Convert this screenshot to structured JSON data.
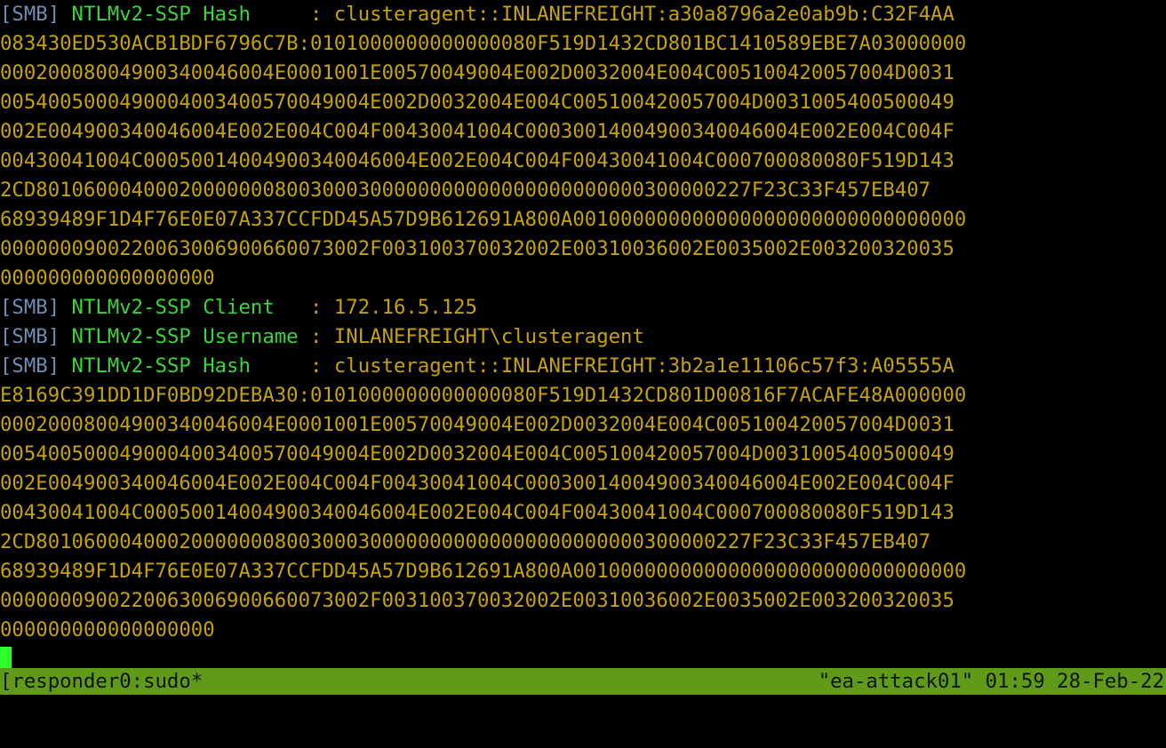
{
  "terminal": {
    "lines": [
      {
        "tag": "[SMB]",
        "label": " NTLMv2-SSP Hash     ",
        "value": ": clusteragent::INLANEFREIGHT:a30a8796a2e0ab9b:C32F4AA"
      },
      {
        "text": "083430ED530ACB1BDF6796C7B:0101000000000000080F519D1432CD801BC1410589EBE7A03000000"
      },
      {
        "text": "0002000800490034004600 4E0001001E00570049004E002D0032004E004C005100420057004D0031"
      },
      {
        "text": "0054005000490004003400570049004E002D0032004E004C005100420057004D0031005400500049"
      },
      {
        "text": "002E00490034004600 4E002E004C004F00430041004C000300140049003400460 04E002E004C004F"
      },
      {
        "text": "00430041004C000500140049003400460 04E002E004C004F00430041004C000700080080F519D143"
      },
      {
        "text": "2CD801060004000200000008003000300000000000000000000000300000227F23C33F457EB407"
      },
      {
        "text": "68939489F1D4F76E0E07A337CCFDD45A57D9B612691A800A001000000000000000000000000000000"
      },
      {
        "text": "000000090022006300690066 0073002F003100370032002E00310036002E0035002E003200320035"
      },
      {
        "text": "000000000000000000"
      },
      {
        "tag": "[SMB]",
        "label": " NTLMv2-SSP Client   ",
        "value": ": 172.16.5.125"
      },
      {
        "tag": "[SMB]",
        "label": " NTLMv2-SSP Username ",
        "value": ": INLANEFREIGHT\\clusteragent"
      },
      {
        "tag": "[SMB]",
        "label": " NTLMv2-SSP Hash     ",
        "value": ": clusteragent::INLANEFREIGHT:3b2a1e11106c57f3:A05555A"
      },
      {
        "text": "E8169C391DD1DF0BD92DEBA30:0101000000000000080F519D1432CD801D00816F7ACAFE48A000000"
      },
      {
        "text": "0002000800490034004600 4E0001001E00570049004E002D0032004E004C005100420057004D0031"
      },
      {
        "text": "0054005000490004003400570049004E002D0032004E004C005100420057004D0031005400500049"
      },
      {
        "text": "002E00490034004600 4E002E004C004F00430041004C000300140049003400460 04E002E004C004F"
      },
      {
        "text": "00430041004C000500140049003400460 04E002E004C004F00430041004C000700080080F519D143"
      },
      {
        "text": "2CD801060004000200000008003000300000000000000000000000300000227F23C33F457EB407"
      },
      {
        "text": "68939489F1D4F76E0E07A337CCFDD45A57D9B612691A800A001000000000000000000000000000000"
      },
      {
        "text": "000000090022006300690066 0073002F003100370032002E00310036002E0035002E003200320035"
      },
      {
        "text": "000000000000000000"
      }
    ]
  },
  "statusbar": {
    "left": "[responder0:sudo*",
    "right": "\"ea-attack01\" 01:59 28-Feb-22"
  },
  "colors": {
    "background": "#000000",
    "tag": "#6d8fb6",
    "label": "#3ad63a",
    "value": "#c5a20c",
    "statusbar": "#5f9a19",
    "cursor": "#2dff2d"
  }
}
